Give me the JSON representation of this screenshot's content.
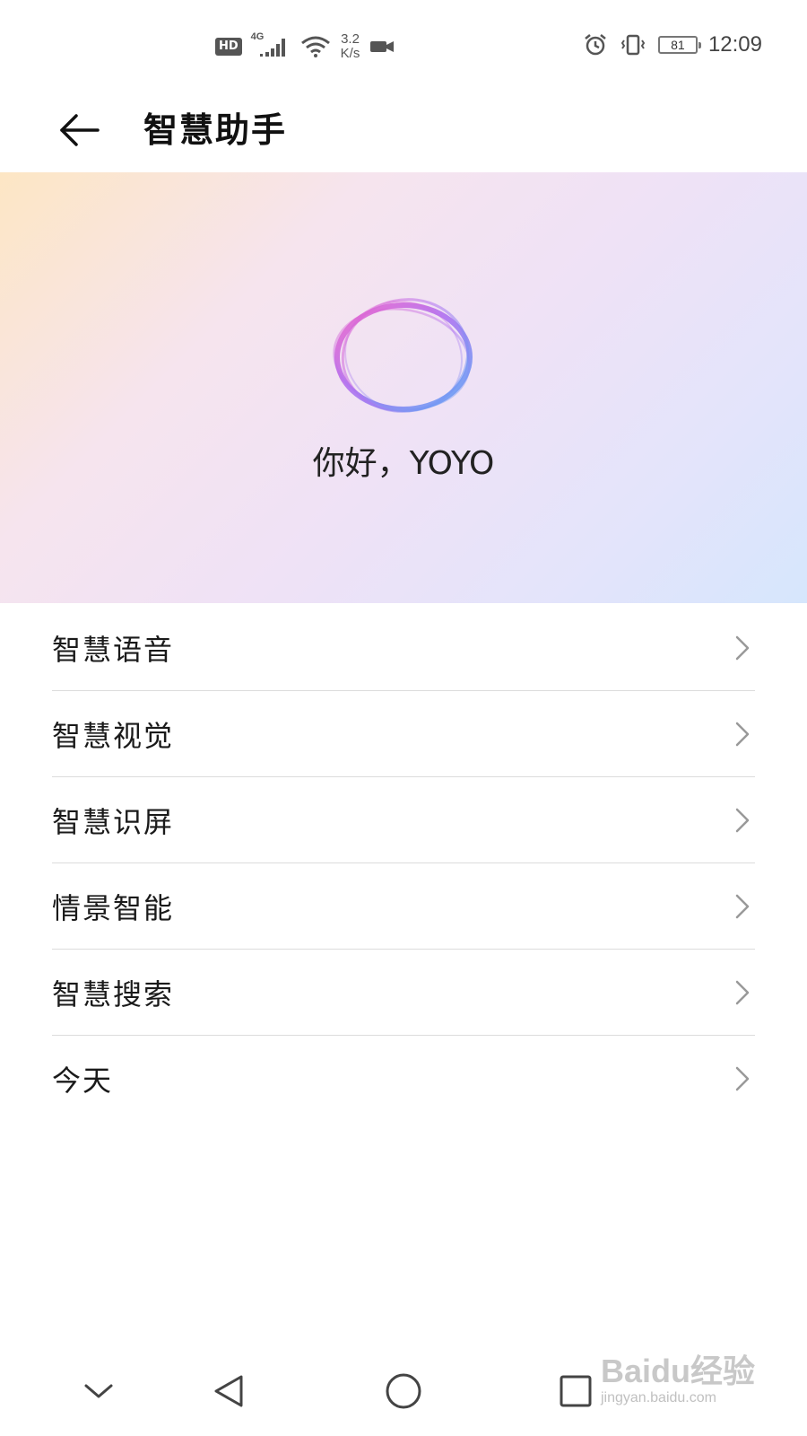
{
  "status_bar": {
    "hd_label": "HD",
    "network_type": "4G",
    "speed_value": "3.2",
    "speed_unit": "K/s",
    "battery_level": "81",
    "time": "12:09",
    "icons": [
      "hd-icon",
      "signal-icon",
      "wifi-icon",
      "camera-icon",
      "alarm-icon",
      "vibrate-icon",
      "battery-icon"
    ]
  },
  "header": {
    "back_icon": "arrow-left-icon",
    "title": "智慧助手"
  },
  "hero": {
    "greeting": "你好，YOYO",
    "orb_icon": "voice-orb-icon"
  },
  "menu": {
    "items": [
      {
        "label": "智慧语音"
      },
      {
        "label": "智慧视觉"
      },
      {
        "label": "智慧识屏"
      },
      {
        "label": "情景智能"
      },
      {
        "label": "智慧搜索"
      },
      {
        "label": "今天"
      }
    ],
    "chevron_icon": "chevron-right-icon"
  },
  "nav_bar": {
    "buttons": [
      "chevron-down-icon",
      "back-triangle-icon",
      "home-circle-icon",
      "recents-square-icon"
    ]
  },
  "watermark": {
    "logo": "Baidu经验",
    "url": "jingyan.baidu.com"
  },
  "colors": {
    "background": "#ffffff",
    "hero_gradient_start": "#fde6c4",
    "hero_gradient_mid": "#efe2f6",
    "hero_gradient_end": "#d6e6fc",
    "orb_pink": "#f062c8",
    "orb_blue": "#5aa8f5",
    "divider": "#dcdcdc",
    "chevron": "#999999"
  }
}
